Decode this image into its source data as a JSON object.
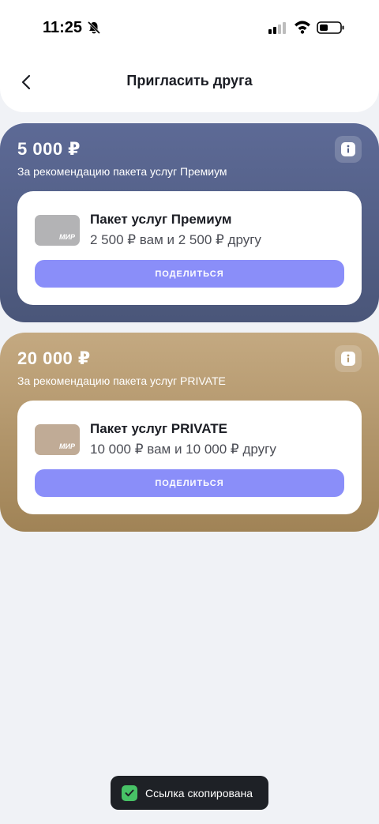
{
  "status_bar": {
    "time": "11:25"
  },
  "header": {
    "title": "Пригласить друга"
  },
  "offers": [
    {
      "amount": "5 000 ₽",
      "subtitle": "За рекомендацию пакета услуг Премиум",
      "card": {
        "title": "Пакет услуг Премиум",
        "description": "2 500 ₽ вам и 2 500 ₽ другу",
        "logo": "МИР",
        "share_label": "ПОДЕЛИТЬСЯ"
      }
    },
    {
      "amount": "20 000 ₽",
      "subtitle": "За рекомендацию пакета услуг PRIVATE",
      "card": {
        "title": "Пакет услуг PRIVATE",
        "description": "10 000 ₽ вам и 10 000 ₽ другу",
        "logo": "МИР",
        "share_label": "ПОДЕЛИТЬСЯ"
      }
    }
  ],
  "toast": {
    "text": "Ссылка скопирована"
  },
  "colors": {
    "premium_block": "#56628a",
    "private_block": "#b59a6e",
    "share_button": "#8a8ef9",
    "toast_bg": "#1e2126",
    "toast_check": "#47c266"
  },
  "icons": [
    "bell-off-icon",
    "signal-icon",
    "wifi-icon",
    "battery-icon",
    "back-icon",
    "info-icon",
    "check-icon"
  ]
}
